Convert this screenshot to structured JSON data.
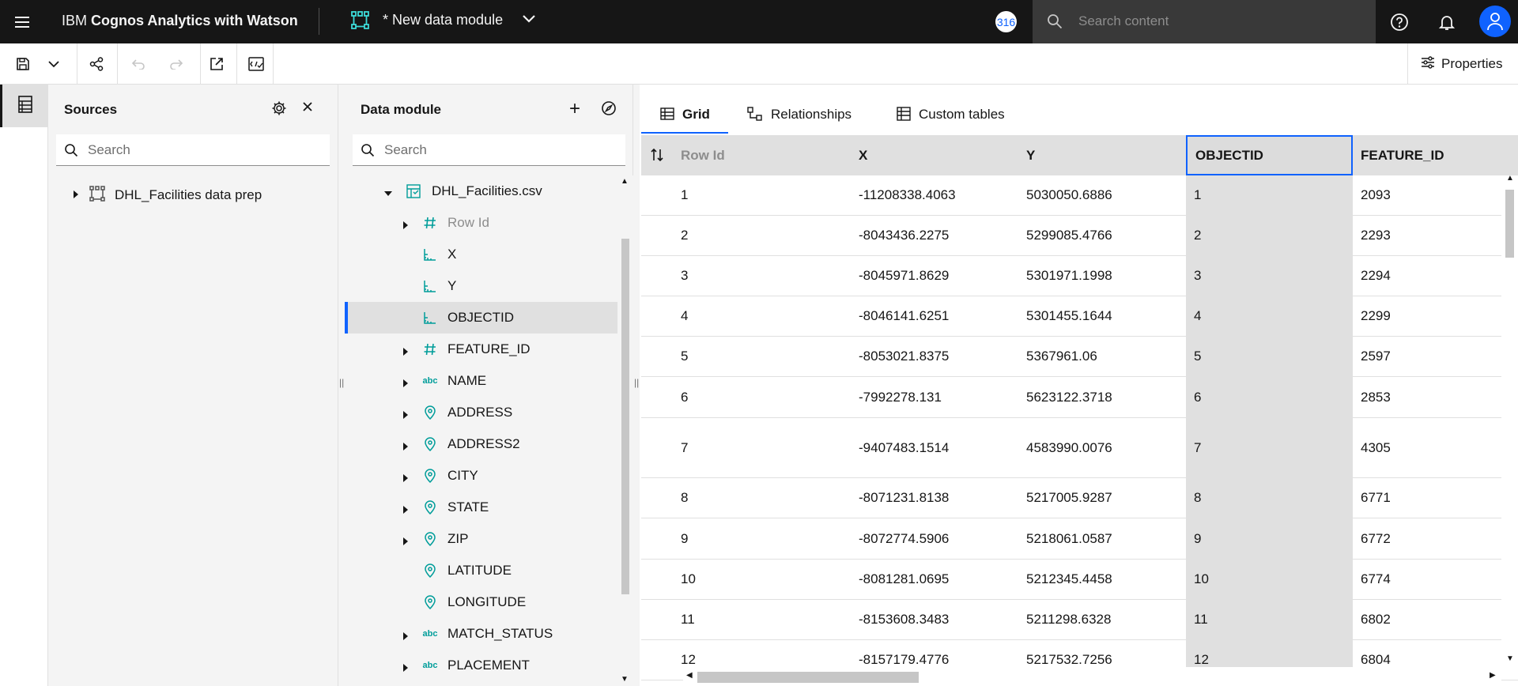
{
  "topbar": {
    "brand_prefix": "IBM",
    "brand_name": "Cognos Analytics with Watson",
    "module_title": "* New data module",
    "notification_count": "316",
    "search_placeholder": "Search content"
  },
  "toolbar": {
    "properties_label": "Properties"
  },
  "sources": {
    "title": "Sources",
    "search_placeholder": "Search",
    "items": [
      {
        "label": "DHL_Facilities data prep"
      }
    ]
  },
  "data_module": {
    "title": "Data module",
    "search_placeholder": "Search",
    "table_name": "DHL_Facilities.csv",
    "columns": [
      {
        "label": "Row Id",
        "type": "number",
        "expandable": true,
        "muted": true
      },
      {
        "label": "X",
        "type": "measure",
        "expandable": false
      },
      {
        "label": "Y",
        "type": "measure",
        "expandable": false
      },
      {
        "label": "OBJECTID",
        "type": "measure",
        "expandable": false,
        "selected": true
      },
      {
        "label": "FEATURE_ID",
        "type": "number",
        "expandable": true
      },
      {
        "label": "NAME",
        "type": "text",
        "expandable": true
      },
      {
        "label": "ADDRESS",
        "type": "geo",
        "expandable": true
      },
      {
        "label": "ADDRESS2",
        "type": "geo",
        "expandable": true
      },
      {
        "label": "CITY",
        "type": "geo",
        "expandable": true
      },
      {
        "label": "STATE",
        "type": "geo",
        "expandable": true
      },
      {
        "label": "ZIP",
        "type": "geo",
        "expandable": true
      },
      {
        "label": "LATITUDE",
        "type": "geo",
        "expandable": false
      },
      {
        "label": "LONGITUDE",
        "type": "geo",
        "expandable": false
      },
      {
        "label": "MATCH_STATUS",
        "type": "text",
        "expandable": true
      },
      {
        "label": "PLACEMENT",
        "type": "text",
        "expandable": true
      }
    ]
  },
  "tabs": [
    {
      "label": "Grid",
      "active": true
    },
    {
      "label": "Relationships",
      "active": false
    },
    {
      "label": "Custom tables",
      "active": false
    }
  ],
  "grid": {
    "headers": [
      "Row Id",
      "X",
      "Y",
      "OBJECTID",
      "FEATURE_ID"
    ],
    "rows": [
      [
        "1",
        "-11208338.4063",
        "5030050.6886",
        "1",
        "2093"
      ],
      [
        "2",
        "-8043436.2275",
        "5299085.4766",
        "2",
        "2293"
      ],
      [
        "3",
        "-8045971.8629",
        "5301971.1998",
        "3",
        "2294"
      ],
      [
        "4",
        "-8046141.6251",
        "5301455.1644",
        "4",
        "2299"
      ],
      [
        "5",
        "-8053021.8375",
        "5367961.06",
        "5",
        "2597"
      ],
      [
        "6",
        "-7992278.131",
        "5623122.3718",
        "6",
        "2853"
      ],
      [
        "7",
        "-9407483.1514",
        "4583990.0076",
        "7",
        "4305"
      ],
      [
        "8",
        "-8071231.8138",
        "5217005.9287",
        "8",
        "6771"
      ],
      [
        "9",
        "-8072774.5906",
        "5218061.0587",
        "9",
        "6772"
      ],
      [
        "10",
        "-8081281.0695",
        "5212345.4458",
        "10",
        "6774"
      ],
      [
        "11",
        "-8153608.3483",
        "5211298.6328",
        "11",
        "6802"
      ],
      [
        "12",
        "-8157179.4776",
        "5217532.7256",
        "12",
        "6804"
      ]
    ]
  }
}
